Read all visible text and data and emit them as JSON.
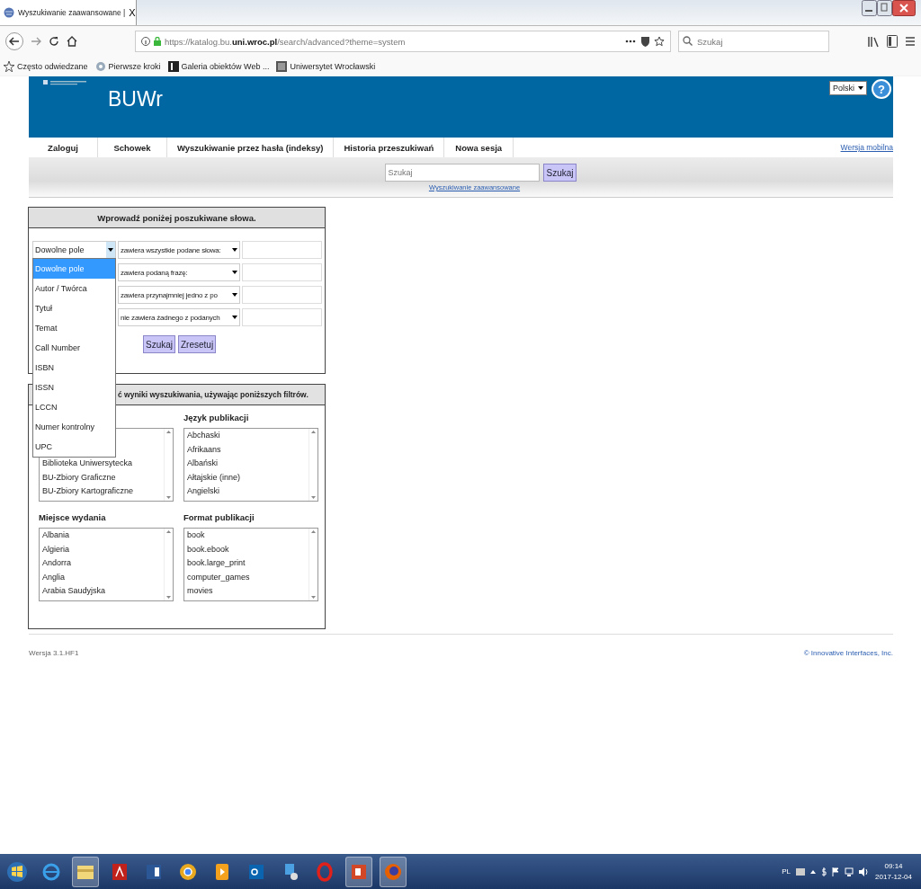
{
  "browser": {
    "tab_title": "Wyszukiwanie zaawansowane |",
    "tab_close": "X",
    "address": "https://katalog.bu.**uni.wroc.pl**/search/advanced?theme=system",
    "search_placeholder": "Szukaj",
    "bookmarks": [
      "Często odwiedzane",
      "Pierwsze kroki",
      "Galeria obiektów Web ...",
      "Uniwersytet Wrocławski"
    ]
  },
  "header": {
    "logo": "BUWr",
    "language": "Polski",
    "help": "?"
  },
  "nav": {
    "items": [
      "Zaloguj",
      "Schowek",
      "Wyszukiwanie przez hasła (indeksy)",
      "Historia przeszukiwań",
      "Nowa sesja"
    ],
    "mobile_link": "Wersja mobilna"
  },
  "quick_search": {
    "placeholder": "Szukaj",
    "button": "Szukaj",
    "advanced_link": "Wyszukiwanie zaawansowane"
  },
  "search_form": {
    "title": "Wprowadź poniżej poszukiwane słowa.",
    "field_select": {
      "value": "Dowolne pole",
      "expanded": true,
      "options": [
        {
          "label": "Dowolne pole",
          "selected": true
        },
        {
          "label": "Autor / Twórca",
          "selected": false
        },
        {
          "label": "Tytuł",
          "selected": false
        },
        {
          "label": "Temat",
          "selected": false
        },
        {
          "label": "Call Number",
          "selected": false
        },
        {
          "label": "ISBN",
          "selected": false
        },
        {
          "label": "ISSN",
          "selected": false
        },
        {
          "label": "LCCN",
          "selected": false
        },
        {
          "label": "Numer kontrolny",
          "selected": false
        },
        {
          "label": "UPC",
          "selected": false
        }
      ]
    },
    "rows": [
      {
        "operator": "zawiera wszystkie podane słowa:"
      },
      {
        "operator": "zawiera podaną frazę:"
      },
      {
        "operator": "zawiera przynajmniej jedno z po"
      },
      {
        "operator": "nie zawiera żadnego z podanych"
      }
    ],
    "buttons": [
      "Szukaj",
      "Zresetuj"
    ]
  },
  "filters": {
    "title": "ć wyniki wyszukiwania, używając poniższych filtrów.",
    "partly_hidden_list": {
      "items": [
        "Biblioteka Uniwersytecka",
        "BU-Zbiory Graficzne",
        "BU-Zbiory Kartograficzne"
      ]
    },
    "groups": [
      {
        "label": "Język publikacji",
        "items": [
          "Abchaski",
          "Afrikaans",
          "Albański",
          "Ałtajskie (inne)",
          "Angielski"
        ]
      },
      {
        "label": "Miejsce wydania",
        "items": [
          "Albania",
          "Algieria",
          "Andorra",
          "Anglia",
          "Arabia Saudyjska"
        ]
      },
      {
        "label": "Format publikacji",
        "items": [
          "book",
          "book.ebook",
          "book.large_print",
          "computer_games",
          "movies"
        ]
      }
    ]
  },
  "footer": {
    "version": "Wersja 3.1.HF1",
    "copyright": "© Innovative Interfaces, Inc."
  },
  "taskbar": {
    "language": "PL",
    "time": "09:14",
    "date": "2017-12-04"
  }
}
